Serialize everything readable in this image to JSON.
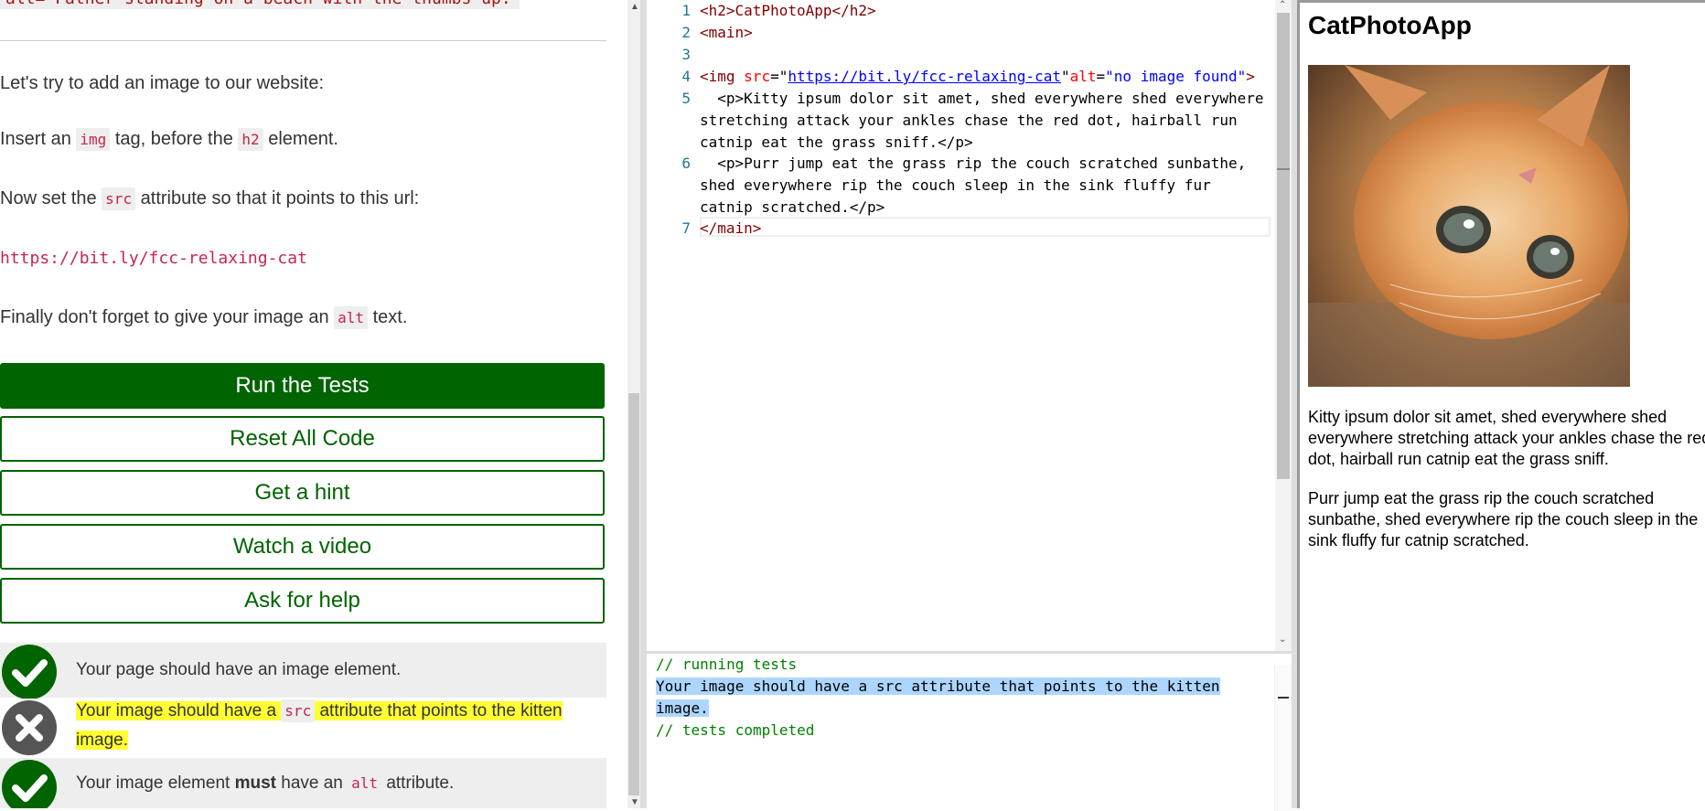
{
  "instructions": {
    "top_snippet": "alt=\"Father standing on a beach with the thumbs up.\">",
    "para1": "Let's try to add an image to our website:",
    "para2": {
      "a": "Insert an ",
      "code1": "img",
      "b": " tag, before the ",
      "code2": "h2",
      "c": " element."
    },
    "para3": {
      "a": "Now set the ",
      "code1": "src",
      "b": " attribute so that it points to this url:"
    },
    "url": "https://bit.ly/fcc-relaxing-cat",
    "para4": {
      "a": "Finally don't forget to give your image an ",
      "code1": "alt",
      "b": " text."
    }
  },
  "buttons": {
    "run": "Run the Tests",
    "reset": "Reset All Code",
    "hint": "Get a hint",
    "video": "Watch a video",
    "help": "Ask for help"
  },
  "tests": [
    {
      "status": "pass",
      "text": "Your page should have an image element."
    },
    {
      "status": "fail",
      "a": "Your image should have a ",
      "code": "src",
      "b": " attribute that points to the kitten",
      "c": "image."
    },
    {
      "status": "pass",
      "a": "Your image element ",
      "strong": "must",
      "b": " have an ",
      "code": "alt",
      "c": " attribute."
    }
  ],
  "editor": {
    "line_numbers": [
      "1",
      "2",
      "3",
      "4",
      "5",
      "6",
      "7"
    ],
    "l1": "<h2>CatPhotoApp</h2>",
    "l2": "<main>",
    "l4": {
      "open": "<img ",
      "src_attr": "src",
      "eq": "=\"",
      "src_val": "https://bit.ly/fcc-relaxing-cat",
      "q": "\"",
      "alt_attr": "alt",
      "eq2": "=",
      "alt_val": "\"no image found\"",
      "close": ">"
    },
    "l5a": "  <p>Kitty ipsum dolor sit amet, shed everywhere shed everywhere",
    "l5b": "stretching attack your ankles chase the red dot, hairball run",
    "l5c": "catnip eat the grass sniff.</p>",
    "l6a": "  <p>Purr jump eat the grass rip the couch scratched sunbathe,",
    "l6b": "shed everywhere rip the couch sleep in the sink fluffy fur",
    "l6c": "catnip scratched.</p>",
    "l7": "</main>"
  },
  "console": {
    "c1": "// running tests",
    "c2": "Your image should have a src attribute that points to the kitten",
    "c3": "image.",
    "c4": "// tests completed"
  },
  "preview": {
    "title": "CatPhotoApp",
    "p1": "Kitty ipsum dolor sit amet, shed everywhere shed everywhere stretching attack your ankles chase the red dot, hairball run catnip eat the grass sniff.",
    "p2": "Purr jump eat the grass rip the couch scratched sunbathe, shed everywhere rip the couch sleep in the sink fluffy fur catnip scratched."
  },
  "colors": {
    "fcc_green": "#006400",
    "code_red": "#c7254e",
    "highlight": "#ffff33",
    "selection": "#add6ff"
  }
}
